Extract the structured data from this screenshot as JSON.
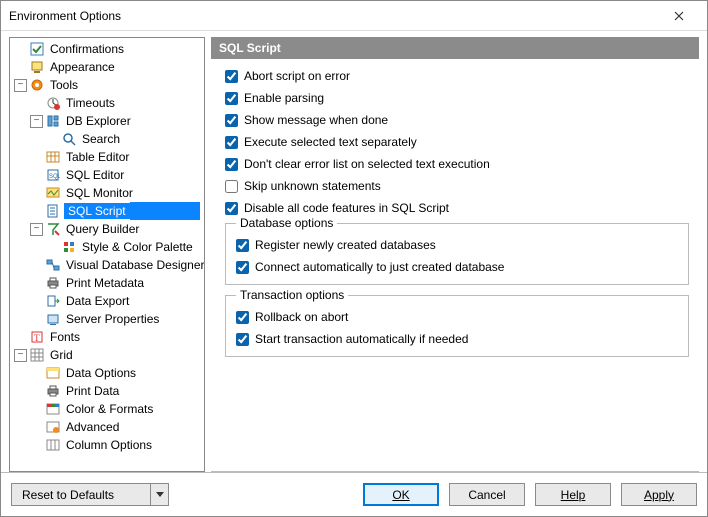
{
  "window": {
    "title": "Environment Options"
  },
  "header": {
    "title": "SQL Script"
  },
  "options": {
    "abort_on_error": {
      "label": "Abort script on error",
      "checked": true
    },
    "enable_parsing": {
      "label": "Enable parsing",
      "checked": true
    },
    "show_message_done": {
      "label": "Show message when done",
      "checked": true
    },
    "exec_selected_sep": {
      "label": "Execute selected text separately",
      "checked": true
    },
    "dont_clear_error": {
      "label": "Don't clear error list on selected text execution",
      "checked": true
    },
    "skip_unknown": {
      "label": "Skip unknown statements",
      "checked": false
    },
    "disable_code_feat": {
      "label": "Disable all code features in SQL Script",
      "checked": true
    }
  },
  "groups": {
    "database": {
      "legend": "Database options",
      "register_new": {
        "label": "Register newly created databases",
        "checked": true
      },
      "connect_auto": {
        "label": "Connect automatically to just created database",
        "checked": true
      }
    },
    "transaction": {
      "legend": "Transaction options",
      "rollback_abort": {
        "label": "Rollback on abort",
        "checked": true
      },
      "start_txn_auto": {
        "label": "Start transaction automatically if needed",
        "checked": true
      }
    }
  },
  "tree": {
    "confirmations": "Confirmations",
    "appearance": "Appearance",
    "tools": "Tools",
    "timeouts": "Timeouts",
    "db_explorer": "DB Explorer",
    "search": "Search",
    "table_editor": "Table Editor",
    "sql_editor": "SQL Editor",
    "sql_monitor": "SQL Monitor",
    "sql_script": "SQL Script",
    "query_builder": "Query Builder",
    "style_palette": "Style & Color Palette",
    "vdb_designer": "Visual Database Designer",
    "print_metadata": "Print Metadata",
    "data_export": "Data Export",
    "server_properties": "Server Properties",
    "fonts": "Fonts",
    "grid": "Grid",
    "data_options": "Data Options",
    "print_data": "Print Data",
    "color_formats": "Color & Formats",
    "advanced": "Advanced",
    "column_options": "Column Options"
  },
  "buttons": {
    "reset": "Reset to Defaults",
    "ok": "OK",
    "cancel": "Cancel",
    "help": "Help",
    "apply": "Apply"
  }
}
